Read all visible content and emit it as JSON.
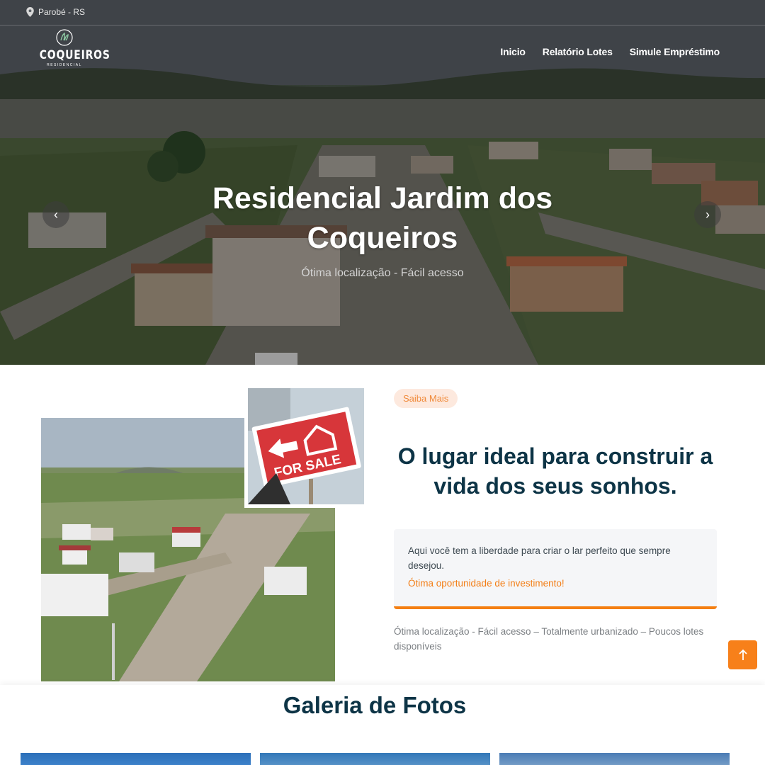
{
  "topbar": {
    "location": "Parobé - RS"
  },
  "logo": {
    "name": "COQUEIROS",
    "subtitle": "RESIDENCIAL"
  },
  "nav": {
    "items": [
      "Inicio",
      "Relatório Lotes",
      "Simule Empréstimo"
    ]
  },
  "hero": {
    "title": "Residencial Jardim dos Coqueiros",
    "subtitle": "Ótima localização - Fácil acesso",
    "prev_icon": "chevron-left-icon",
    "next_icon": "chevron-right-icon"
  },
  "about": {
    "badge": "Saiba Mais",
    "title": "O lugar ideal para construir a vida dos seus sonhos.",
    "card_text": "Aqui você tem a liberdade para criar o lar perfeito que sempre desejou.",
    "card_highlight": "Ótima oportunidade de investimento!",
    "features": "Ótima localização - Fácil acesso – Totalmente urbanizado – Poucos lotes disponíveis",
    "sign_text": "FOR SALE"
  },
  "gallery": {
    "title": "Galeria de Fotos"
  },
  "back_to_top": {
    "icon": "arrow-up-icon"
  },
  "colors": {
    "accent": "#f47f12",
    "heading": "#0d3446",
    "badge_bg": "#fde9de"
  }
}
